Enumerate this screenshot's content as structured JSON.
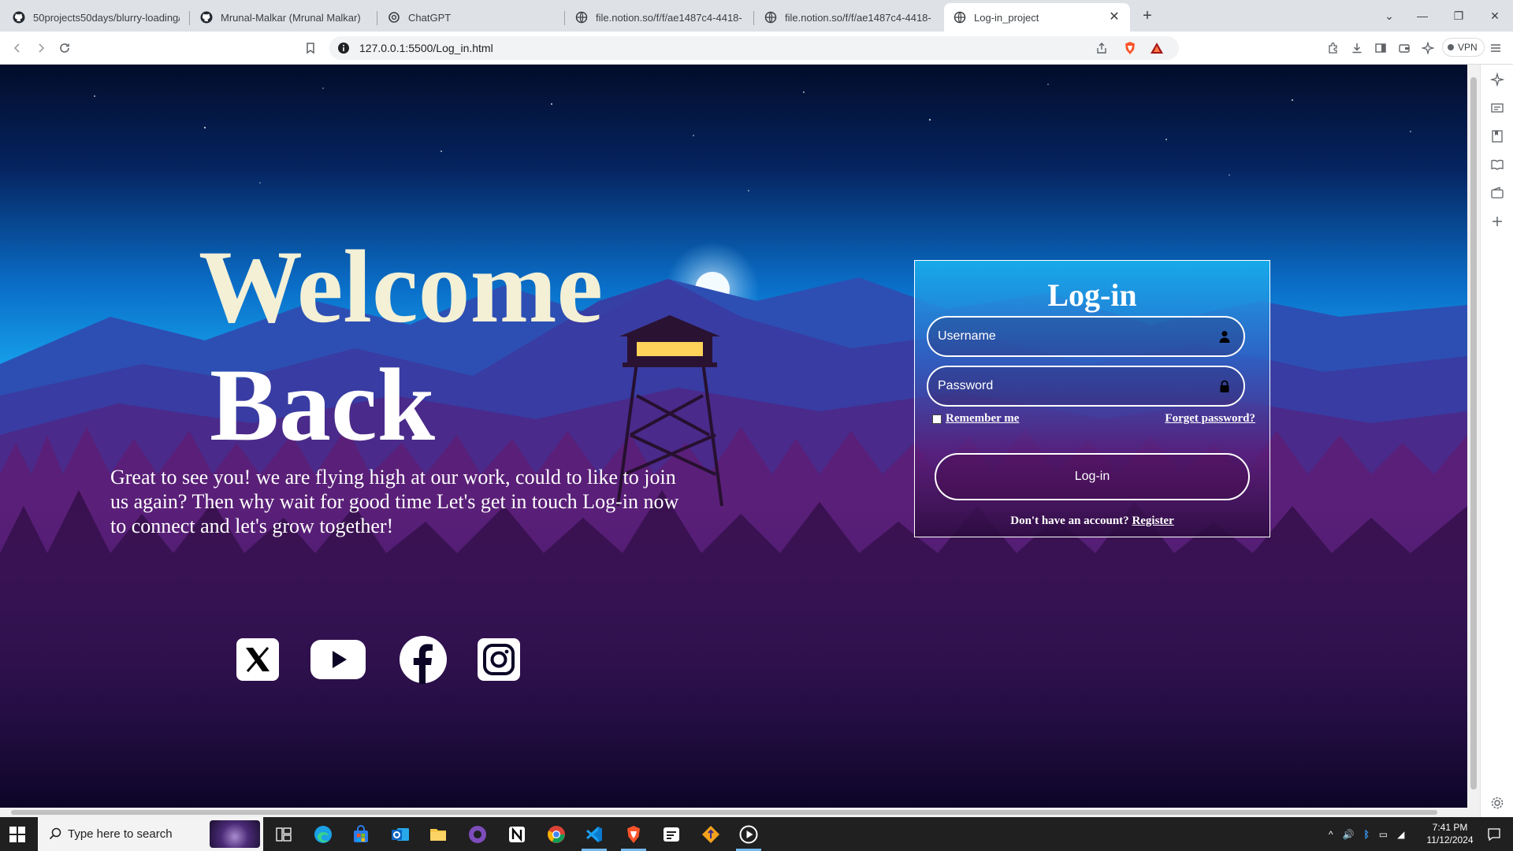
{
  "browser": {
    "tabs": [
      {
        "title": "50projects50days/blurry-loading/in",
        "favicon": "github-icon",
        "active": false
      },
      {
        "title": "Mrunal-Malkar (Mrunal Malkar)",
        "favicon": "github-icon",
        "active": false
      },
      {
        "title": "ChatGPT",
        "favicon": "chatgpt-icon",
        "active": false
      },
      {
        "title": "file.notion.so/f/f/ae1487c4-4418-42",
        "favicon": "globe-icon",
        "active": false
      },
      {
        "title": "file.notion.so/f/f/ae1487c4-4418-42",
        "favicon": "globe-icon",
        "active": false
      },
      {
        "title": "Log-in_project",
        "favicon": "globe-icon",
        "active": true
      }
    ],
    "address": "127.0.0.1:5500/Log_in.html",
    "vpn_label": "VPN"
  },
  "page": {
    "welcome": "Welcome",
    "back": "Back",
    "intro": "Great to see you! we are flying high at our work, could to like to join us again? Then why wait for good time Let's get in touch Log-in now to connect and let's grow together!",
    "social": [
      "x-icon",
      "youtube-icon",
      "facebook-icon",
      "instagram-icon"
    ],
    "login": {
      "title": "Log-in",
      "username_placeholder": "Username",
      "password_placeholder": "Password",
      "remember": "Remember me",
      "forgot": "Forget password?",
      "button": "Log-in",
      "no_account": "Don't have an account?",
      "register": "Register"
    }
  },
  "taskbar": {
    "search_placeholder": "Type here to search",
    "time": "7:41 PM",
    "date": "11/12/2024"
  },
  "colors": {
    "welcome": "#f3f0d6",
    "sky_top": "#030c2a",
    "sky_mid": "#0a6fc9",
    "night_ground": "#0c0526",
    "taskbar": "#202020"
  }
}
